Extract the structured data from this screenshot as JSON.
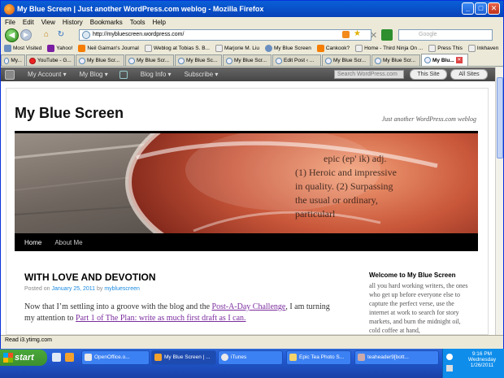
{
  "window": {
    "title": "My Blue Screen | Just another WordPress.com weblog - Mozilla Firefox",
    "minimize": "_",
    "maximize": "□",
    "close": "✕"
  },
  "menu": [
    "File",
    "Edit",
    "View",
    "History",
    "Bookmarks",
    "Tools",
    "Help"
  ],
  "nav": {
    "back": "◀",
    "forward": "▶",
    "home": "⌂",
    "reload": "↻",
    "url": "http://mybluescreen.wordpress.com/",
    "stop": "✕",
    "search_placeholder": "Google"
  },
  "bookmarks": [
    "Most Visited",
    "Yahoo!",
    "Neil Gaiman's Journal",
    "Weblog at Tobias S. B...",
    "Marjorie M. Liu",
    "My Blue Screen",
    "Cankook?",
    "Home - Third Ninja On ...",
    "Press This",
    "Inkhaven"
  ],
  "tabs": [
    {
      "label": "My..."
    },
    {
      "label": "YouTube - G..."
    },
    {
      "label": "My Blue Scr..."
    },
    {
      "label": "My Blue Scr..."
    },
    {
      "label": "My Blue Sc..."
    },
    {
      "label": "My Blue Scr..."
    },
    {
      "label": "Edit Post ‹ ..."
    },
    {
      "label": "My Blue Scr..."
    },
    {
      "label": "My Blue Scr..."
    },
    {
      "label": "My Blu...",
      "active": true
    }
  ],
  "adminbar": {
    "my_account": "My Account ▾",
    "my_blog": "My Blog ▾",
    "blog_info": "Blog Info ▾",
    "subscribe": "Subscribe ▾",
    "search_placeholder": "Search WordPress.com",
    "this_site": "This Site",
    "all_sites": "All Sites"
  },
  "site": {
    "title": "My Blue Screen",
    "tagline": "Just another WordPress.com weblog",
    "header_text": [
      "epic (ep' ik) adj.",
      "(1) Heroic and impressive",
      "in quality. (2) Surpassing",
      "the usual or ordinary,",
      "particularl"
    ]
  },
  "main_nav": [
    "Home",
    "About Me"
  ],
  "post": {
    "title": "WITH LOVE AND DEVOTION",
    "meta_prefix": "Posted on ",
    "date": "January 25, 2011",
    "meta_by": " by ",
    "author": "mybluescreen",
    "body_1": "Now that I’m settling into a groove with the blog and the ",
    "link_1": "Post-A-Day Challenge",
    "body_2": ", I am turning my attention to ",
    "link_2": "Part 1 of The Plan:  write as much first draft as I can."
  },
  "widget": {
    "title": "Welcome to My Blue Screen",
    "text": "all you hard working writers, the ones who get up before everyone else to capture the perfect verse, use the internet at work to search for story markets, and burn the midnight oil, cold coffee at hand,"
  },
  "statusbar": "Read i3.ytimg.com",
  "taskbar": {
    "start": "start",
    "items": [
      {
        "label": "OpenOffice.o..."
      },
      {
        "label": "My Blue Screen | ...",
        "active": true
      },
      {
        "label": "iTunes"
      },
      {
        "label": "Epic Tea Photo S..."
      },
      {
        "label": "teaheader9[bott..."
      }
    ],
    "time": "9:16 PM",
    "day": "Wednesday",
    "date": "1/26/2011"
  },
  "colors": {
    "title_bar": "#0842b8",
    "taskbar": "#245edb",
    "admin_bar": "#454545",
    "link": "#7b2c9e"
  }
}
